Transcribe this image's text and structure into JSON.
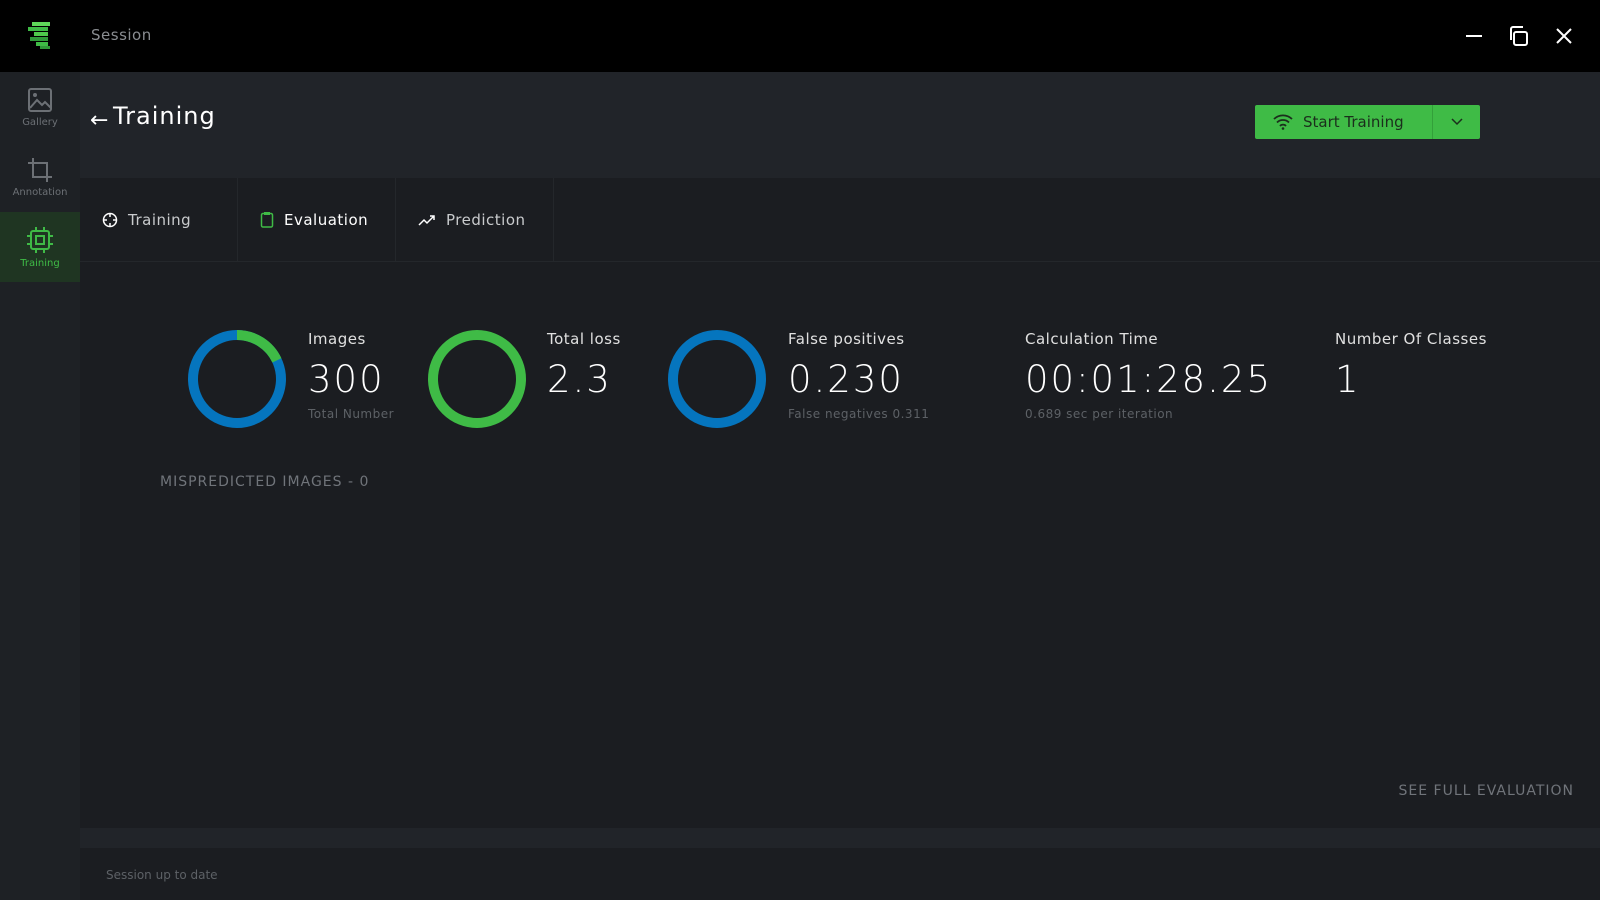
{
  "window": {
    "title": "Session"
  },
  "sidebar": {
    "items": [
      {
        "label": "Gallery"
      },
      {
        "label": "Annotation"
      },
      {
        "label": "Training"
      }
    ]
  },
  "header": {
    "title": "Training",
    "start_button": "Start Training"
  },
  "tabs": [
    {
      "label": "Training"
    },
    {
      "label": "Evaluation"
    },
    {
      "label": "Prediction"
    }
  ],
  "stats": {
    "images": {
      "label": "Images",
      "value": "300",
      "sub": "Total Number",
      "donut_fraction_green": 0.18
    },
    "loss": {
      "label": "Total loss",
      "value": "2.3"
    },
    "fp": {
      "label": "False positives",
      "value": "0.230",
      "sub": "False negatives 0.311"
    },
    "time": {
      "label": "Calculation Time",
      "value": "00:01:28.25",
      "sub": "0.689 sec per iteration"
    },
    "classes": {
      "label": "Number Of Classes",
      "value": "1"
    }
  },
  "mispredicted": "MISPREDICTED IMAGES - 0",
  "see_full": "SEE FULL EVALUATION",
  "status": "Session up to date",
  "colors": {
    "green": "#3fbb46",
    "blue": "#0575be"
  }
}
